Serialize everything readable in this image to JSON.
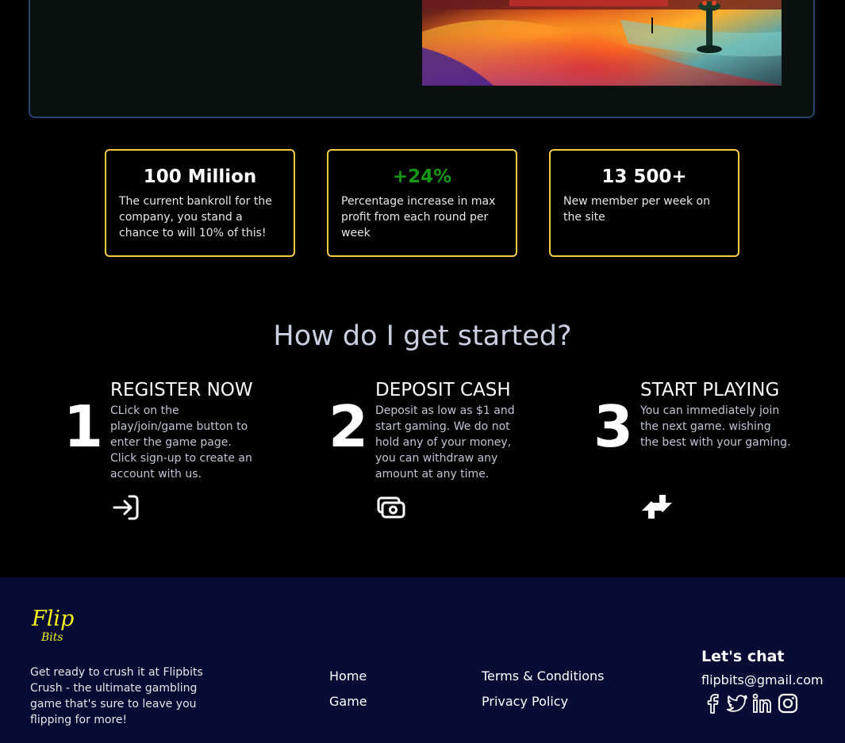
{
  "colors": {
    "accent_gold": "#f7cd3b",
    "growth_green": "#139a12",
    "footer_bg": "#080c34",
    "hero_border": "#27456f",
    "logo_yellow": "#f5f11c"
  },
  "stats": [
    {
      "value": "100 Million",
      "description": "The current bankroll for the company, you stand a chance to will 10% of this!"
    },
    {
      "value": "+24%",
      "description": "Percentage increase in max profit from each round per week"
    },
    {
      "value": "13 500+",
      "description": "New member per week on the site"
    }
  ],
  "started": {
    "title": "How do I get started?",
    "steps": [
      {
        "number": "1",
        "title": "REGISTER NOW",
        "description": "CLick on the play/join/game button to enter the game page. Click sign-up to create an account with us.",
        "icon": "login-arrow-icon"
      },
      {
        "number": "2",
        "title": "DEPOSIT CASH",
        "description": "Deposit as low as $1 and start gaming. We do not hold any of your money, you can withdraw any amount at any time.",
        "icon": "cash-icon"
      },
      {
        "number": "3",
        "title": "START PLAYING",
        "description": "You can immediately join the next game. wishing the best with your gaming.",
        "icon": "flip-arrows-icon"
      }
    ]
  },
  "footer": {
    "logo": {
      "line1": "Flip",
      "line2": "Bits"
    },
    "tagline": "Get ready to crush it at Flipbits Crush - the ultimate gambling game that's sure to leave you flipping for more!",
    "links_col1": [
      "Home",
      "Game"
    ],
    "links_col2": [
      "Terms & Conditions",
      "Privacy Policy"
    ],
    "chat_title": "Let's chat",
    "email": "flipbits@gmail.com",
    "socials": [
      "facebook-icon",
      "twitter-icon",
      "linkedin-icon",
      "instagram-icon"
    ]
  }
}
